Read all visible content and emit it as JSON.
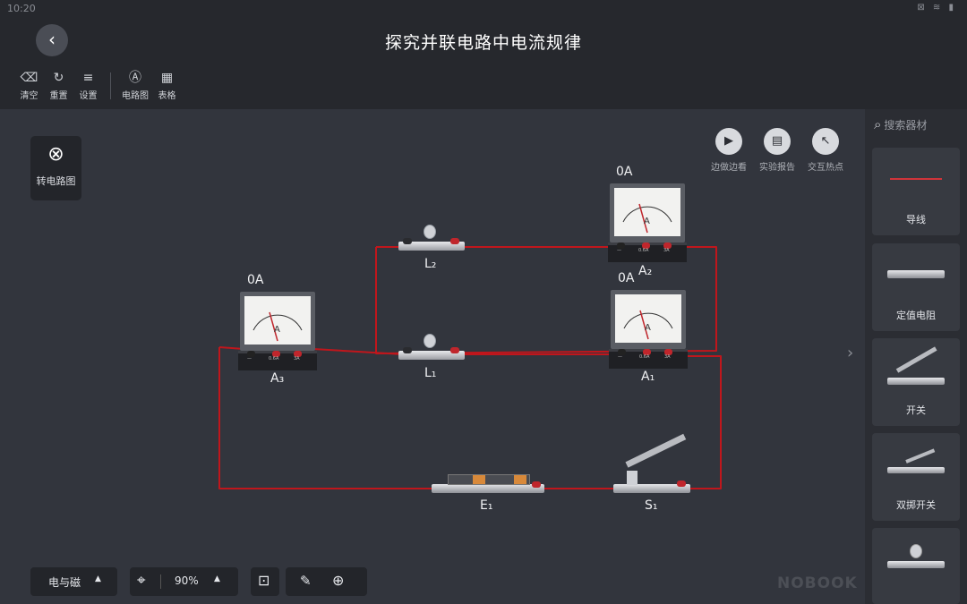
{
  "status": {
    "time": "10:20",
    "icons": "⊠ ≋ ▮"
  },
  "header": {
    "title": "探究并联电路中电流规律",
    "back_icon": "chevron-left-icon",
    "tools": [
      {
        "label": "清空",
        "icon": "trash-icon",
        "glyph": "🗑"
      },
      {
        "label": "重置",
        "icon": "reset-icon",
        "glyph": "↻"
      },
      {
        "label": "设置",
        "icon": "sliders-icon",
        "glyph": "☰"
      },
      {
        "label": "电路图",
        "icon": "circuit-diagram-icon",
        "glyph": "Ⓐ"
      },
      {
        "label": "表格",
        "icon": "table-icon",
        "glyph": "▦"
      }
    ]
  },
  "side": {
    "to_circuit_label": "转电路图"
  },
  "actions": [
    {
      "label": "边做边看",
      "icon": "play-icon",
      "glyph": "▶"
    },
    {
      "label": "实验报告",
      "icon": "report-icon",
      "glyph": "▤"
    },
    {
      "label": "交互热点",
      "icon": "cursor-icon",
      "glyph": "↖"
    }
  ],
  "library": {
    "search_placeholder": "搜索器材",
    "items": [
      {
        "label": "导线"
      },
      {
        "label": "定值电阻"
      },
      {
        "label": "开关"
      },
      {
        "label": "双掷开关"
      },
      {
        "label": ""
      }
    ]
  },
  "components": {
    "A2": {
      "label": "A₂",
      "reading": "0A"
    },
    "A1": {
      "label": "A₁",
      "reading": "0A"
    },
    "A3": {
      "label": "A₃",
      "reading": "0A"
    },
    "L1": {
      "label": "L₁"
    },
    "L2": {
      "label": "L₂"
    },
    "E1": {
      "label": "E₁"
    },
    "S1": {
      "label": "S₁"
    },
    "meter_base_text": {
      "minus": "—",
      "range1": "0.6A",
      "range2": "3A"
    },
    "meter_unit": "A"
  },
  "bottom": {
    "category": "电与磁",
    "zoom": "90%",
    "brand": "NOBOOK"
  },
  "colors": {
    "wire": "#c0161c",
    "background": "#32353d",
    "header": "#26282d"
  }
}
